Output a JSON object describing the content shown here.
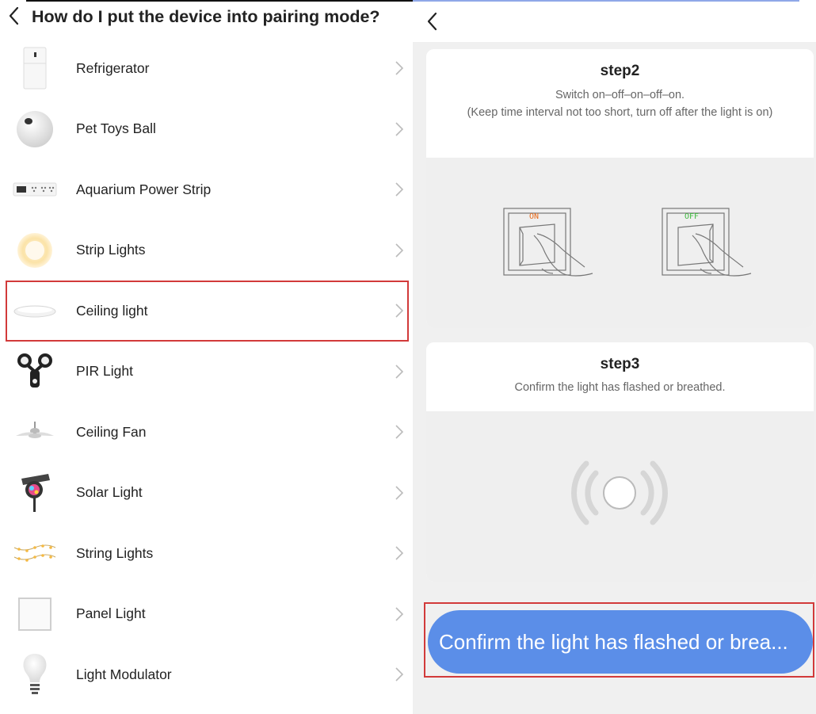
{
  "left": {
    "title": "How do I put the device into pairing mode?",
    "items": [
      {
        "label": "Refrigerator",
        "icon": "refrigerator-icon"
      },
      {
        "label": "Pet Toys Ball",
        "icon": "pet-ball-icon"
      },
      {
        "label": "Aquarium Power Strip",
        "icon": "power-strip-icon"
      },
      {
        "label": "Strip Lights",
        "icon": "strip-lights-icon"
      },
      {
        "label": "Ceiling light",
        "icon": "ceiling-light-icon",
        "highlighted": true
      },
      {
        "label": "PIR Light",
        "icon": "pir-light-icon"
      },
      {
        "label": "Ceiling Fan",
        "icon": "ceiling-fan-icon"
      },
      {
        "label": "Solar Light",
        "icon": "solar-light-icon"
      },
      {
        "label": "String Lights",
        "icon": "string-lights-icon"
      },
      {
        "label": "Panel Light",
        "icon": "panel-light-icon"
      },
      {
        "label": "Light Modulator",
        "icon": "light-bulb-icon"
      }
    ]
  },
  "right": {
    "steps": [
      {
        "title": "step2",
        "desc1": "Switch on–off–on–off–on.",
        "desc2": "(Keep time interval not too short, turn off after the light is on)",
        "switch_on_label": "ON",
        "switch_off_label": "OFF"
      },
      {
        "title": "step3",
        "desc1": "Confirm the light has flashed or breathed."
      }
    ],
    "confirm_button": "Confirm the light has flashed or brea..."
  },
  "colors": {
    "accent": "#5b8ee8",
    "highlight_border": "#d23a3a",
    "on_label": "#e86a1a",
    "off_label": "#3cb83c"
  }
}
